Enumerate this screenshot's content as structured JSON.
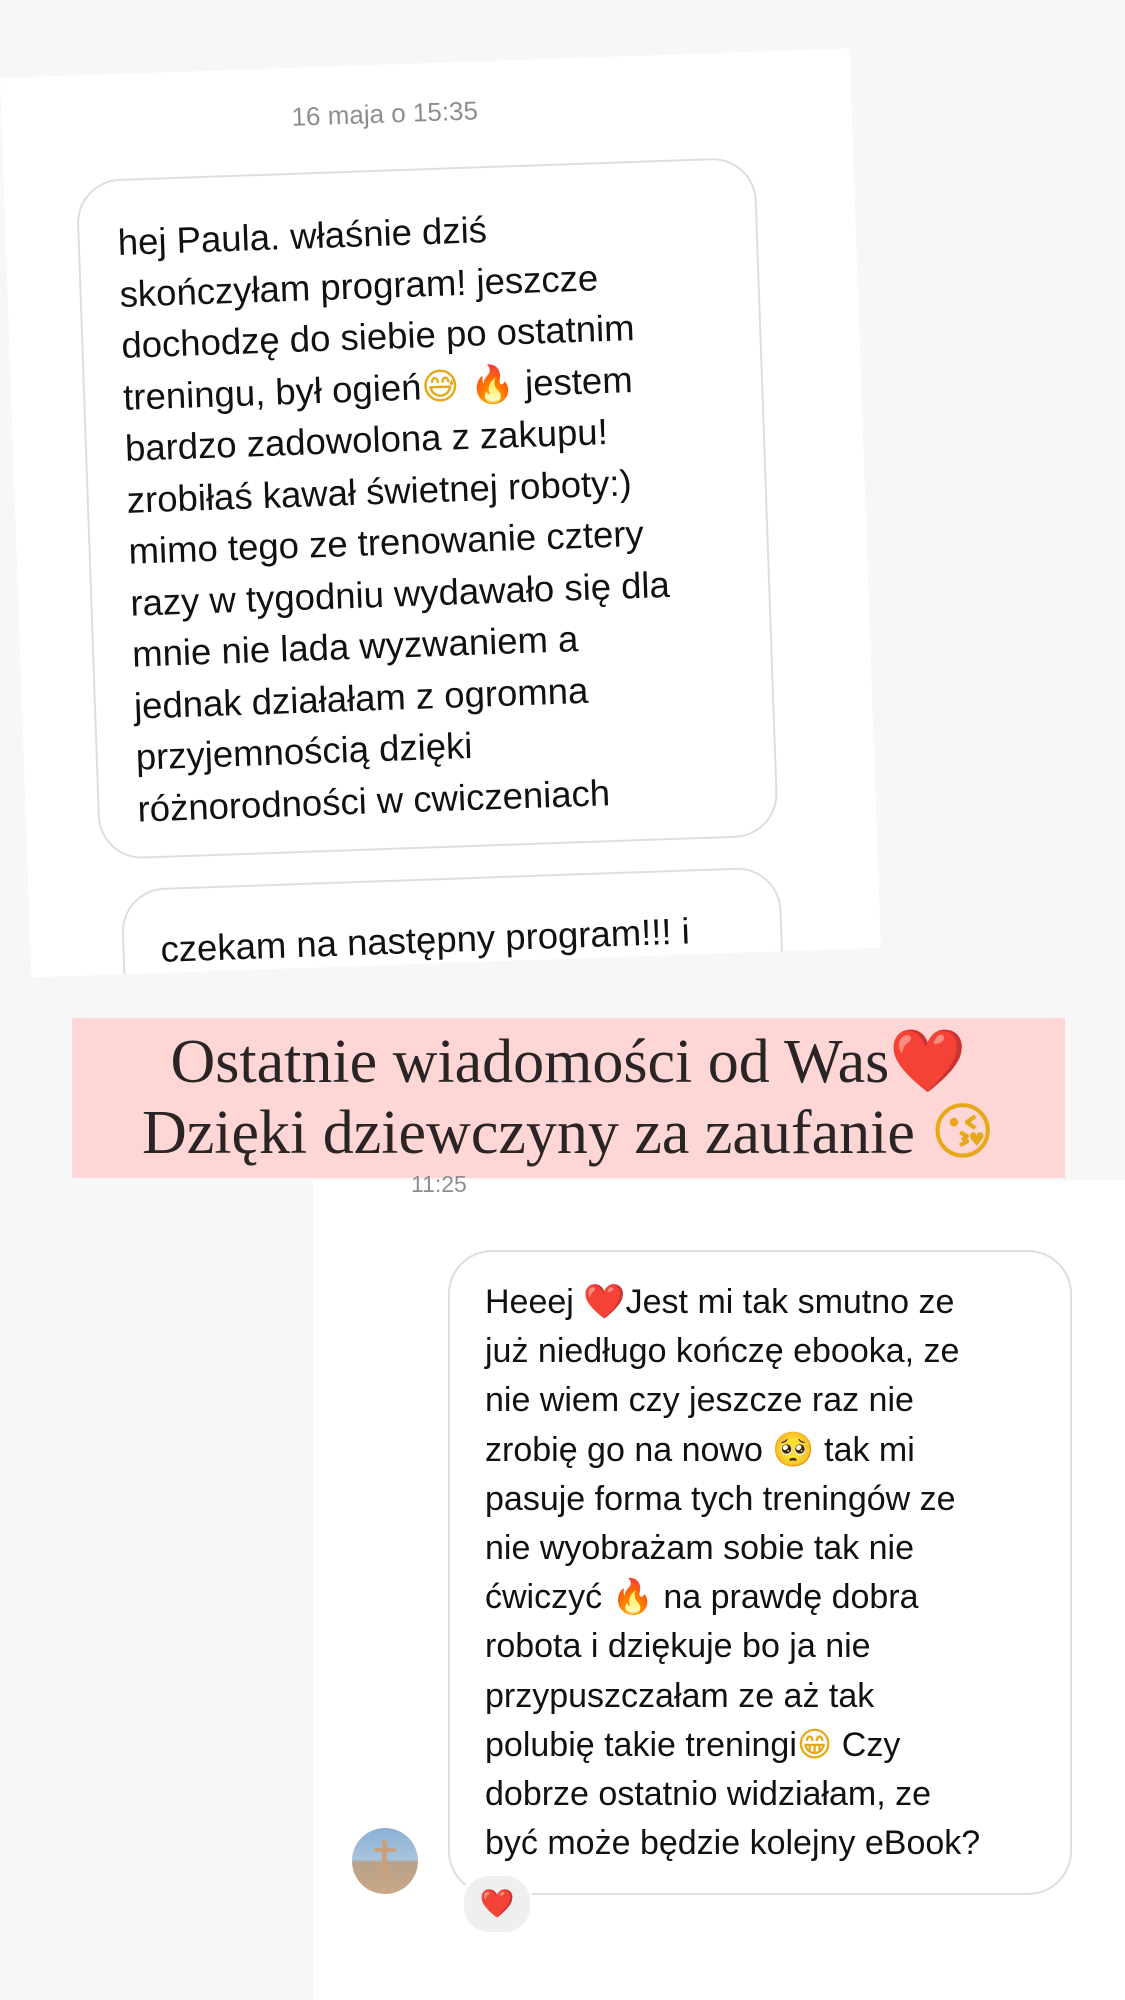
{
  "top_message": {
    "timestamp": "16 maja o 15:35",
    "bubble_1": {
      "lines": [
        "hej Paula. właśnie dziś",
        "skończyłam program! jeszcze",
        "dochodzę do siebie po ostatnim",
        "treningu, był ogień",
        "jestem",
        "bardzo zadowolona z zakupu!",
        "zrobiłaś kawał świetnej roboty:)",
        "mimo tego ze trenowanie cztery",
        "razy w tygodniu wydawało się dla",
        "mnie nie lada wyzwaniem a",
        "jednak działałam z ogromna",
        "przyjemnością dzięki",
        "różnorodności w cwiczeniach"
      ],
      "emoji_sweat": "😅",
      "emoji_fire": "🔥"
    },
    "bubble_2": {
      "text": "czekam na następny program!!! i"
    }
  },
  "banner": {
    "line1": "Ostatnie wiadomości od Was",
    "line1_emoji": "❤️",
    "line2": "Dzięki dziewczyny za zaufanie",
    "line2_emoji": "😘"
  },
  "bottom_message": {
    "timestamp": "11:25",
    "lines": {
      "l1_a": "Heeej",
      "l1_heart": "❤️",
      "l1_b": "Jest mi tak smutno ze",
      "l2": "już niedługo kończę ebooka, ze",
      "l3": "nie wiem czy jeszcze raz nie",
      "l4_a": "zrobię go na nowo",
      "l4_emoji": "🥺",
      "l4_b": "tak mi",
      "l5": "pasuje forma tych treningów ze",
      "l6": "nie wyobrażam sobie tak nie",
      "l7_a": "ćwiczyć",
      "l7_emoji": "🔥",
      "l7_b": "na prawdę dobra",
      "l8": "robota i dziękuje bo ja nie",
      "l9": "przypuszczałam ze aż tak",
      "l10_a": "polubię takie treningi",
      "l10_emoji": "😁",
      "l10_b": "Czy",
      "l11": "dobrze ostatnio widziałam, ze",
      "l12": "być może będzie kolejny eBook?"
    },
    "reaction": "❤️"
  },
  "colors": {
    "banner_background": "#fed6d6",
    "banner_text": "#2a2424",
    "timestamp": "#8e8e8e",
    "bubble_border": "#dedede"
  }
}
